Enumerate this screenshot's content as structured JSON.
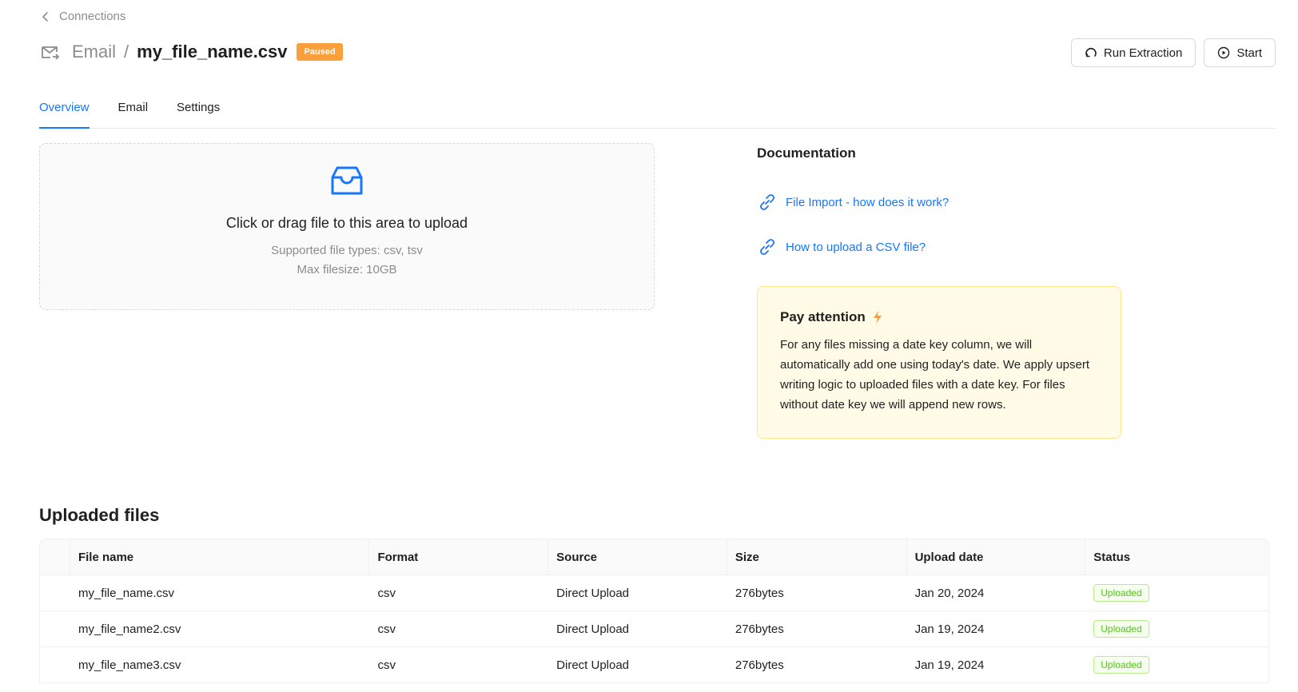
{
  "breadcrumb": {
    "label": "Connections"
  },
  "header": {
    "crumb": "Email",
    "separator": "/",
    "title": "my_file_name.csv",
    "status_badge": "Paused",
    "icon": "mail-sync-icon"
  },
  "actions": {
    "run_extraction": "Run Extraction",
    "start": "Start"
  },
  "tabs": [
    {
      "label": "Overview",
      "active": true
    },
    {
      "label": "Email",
      "active": false
    },
    {
      "label": "Settings",
      "active": false
    }
  ],
  "upload": {
    "title": "Click or drag file to this area to upload",
    "supported": "Supported file types: csv, tsv",
    "max_size": "Max filesize: 10GB",
    "icon": "inbox-icon"
  },
  "documentation": {
    "title": "Documentation",
    "links": [
      {
        "label": "File Import - how does it work?"
      },
      {
        "label": "How to upload a CSV file?"
      }
    ]
  },
  "attention": {
    "title": "Pay attention",
    "body": "For any files missing a date key column, we will automatically add one using today's date. We apply upsert writing logic to uploaded files with a date key. For files without date key we will append new rows."
  },
  "files": {
    "title": "Uploaded files",
    "columns": [
      "File name",
      "Format",
      "Source",
      "Size",
      "Upload date",
      "Status"
    ],
    "rows": [
      {
        "name": "my_file_name.csv",
        "format": "csv",
        "source": "Direct Upload",
        "size": "276bytes",
        "date": "Jan 20, 2024",
        "status": "Uploaded"
      },
      {
        "name": "my_file_name2.csv",
        "format": "csv",
        "source": "Direct Upload",
        "size": "276bytes",
        "date": "Jan 19, 2024",
        "status": "Uploaded"
      },
      {
        "name": "my_file_name3.csv",
        "format": "csv",
        "source": "Direct Upload",
        "size": "276bytes",
        "date": "Jan 19, 2024",
        "status": "Uploaded"
      }
    ]
  },
  "colors": {
    "accent": "#1677ff",
    "paused": "#fa9f3a",
    "success": "#52c41a",
    "attention_bg": "#fffbe6"
  }
}
